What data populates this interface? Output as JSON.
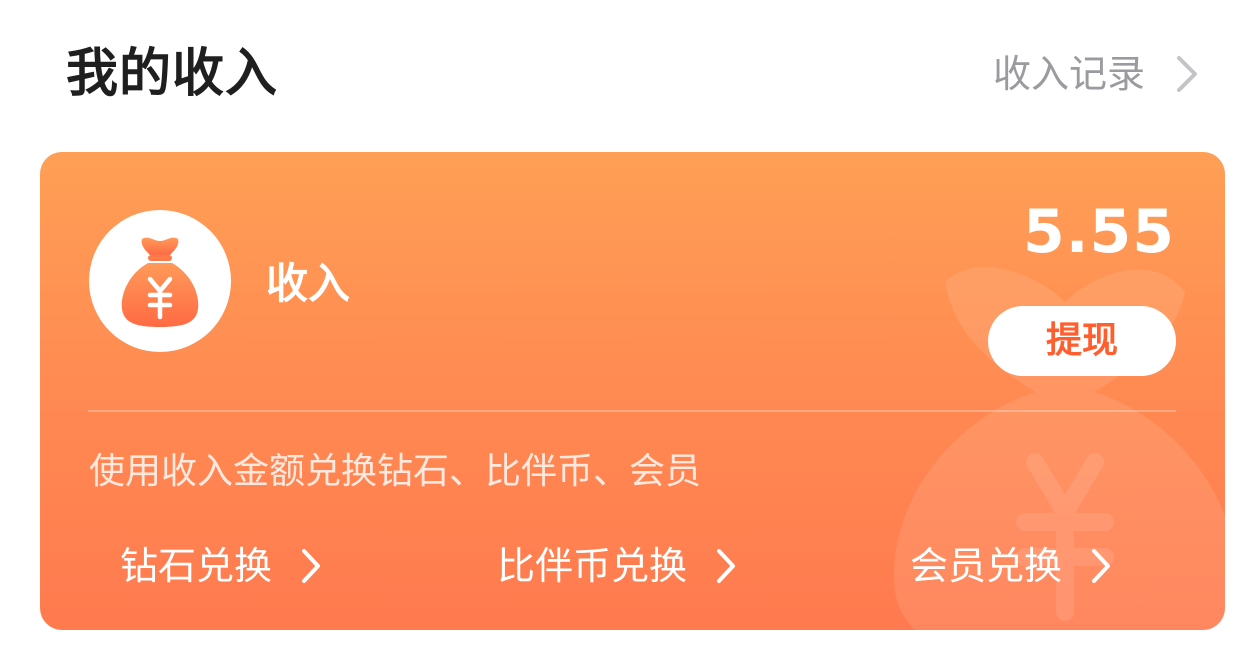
{
  "header": {
    "title": "我的收入",
    "records_link": "收入记录"
  },
  "card": {
    "label": "收入",
    "amount": "5.55",
    "withdraw_label": "提现",
    "exchange_description": "使用收入金额兑换钻石、比伴币、会员",
    "exchange_links": [
      {
        "label": "钻石兑换"
      },
      {
        "label": "比伴币兑换"
      },
      {
        "label": "会员兑换"
      }
    ],
    "icons": {
      "avatar": "money-bag-yuan-icon",
      "chevron": "chevron-right-icon"
    },
    "colors": {
      "gradient_top": "#ff9f55",
      "gradient_bottom": "#ff7a4f",
      "withdraw_text": "#ff5e2e"
    }
  }
}
